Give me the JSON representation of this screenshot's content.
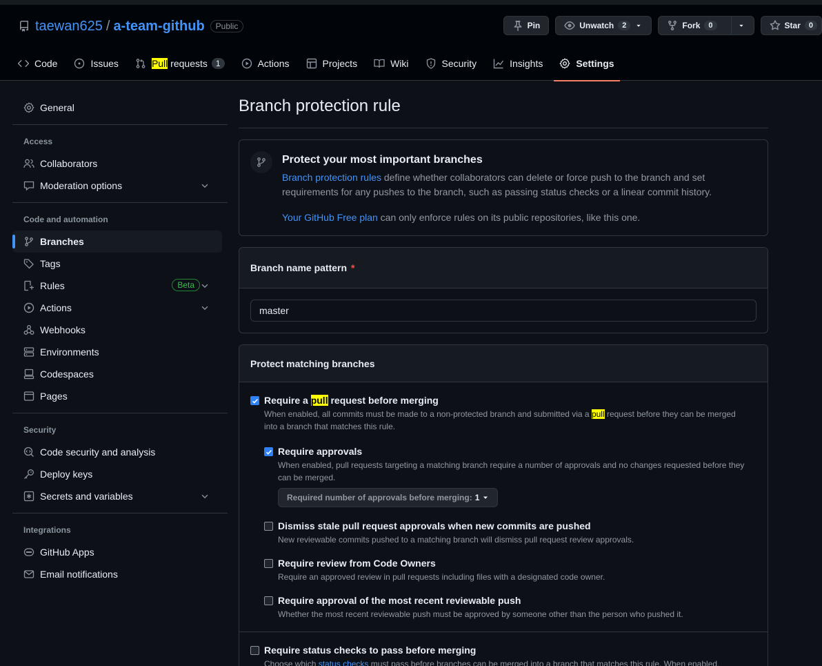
{
  "repo": {
    "owner": "taewan625",
    "name": "a-team-github",
    "visibility": "Public"
  },
  "actions": {
    "pin": "Pin",
    "unwatch": "Unwatch",
    "watch_count": "2",
    "fork": "Fork",
    "fork_count": "0",
    "star": "Star",
    "star_count": "0"
  },
  "nav": {
    "code": "Code",
    "issues": "Issues",
    "pull_hl": "Pull",
    "pull_rest": " requests",
    "pull_count": "1",
    "actions": "Actions",
    "projects": "Projects",
    "wiki": "Wiki",
    "security": "Security",
    "insights": "Insights",
    "settings": "Settings"
  },
  "sidebar": {
    "general": "General",
    "access_heading": "Access",
    "collaborators": "Collaborators",
    "moderation": "Moderation options",
    "code_heading": "Code and automation",
    "branches": "Branches",
    "tags": "Tags",
    "rules": "Rules",
    "rules_badge": "Beta",
    "actions": "Actions",
    "webhooks": "Webhooks",
    "environments": "Environments",
    "codespaces": "Codespaces",
    "pages": "Pages",
    "security_heading": "Security",
    "code_security": "Code security and analysis",
    "deploy_keys": "Deploy keys",
    "secrets": "Secrets and variables",
    "integrations_heading": "Integrations",
    "github_apps": "GitHub Apps",
    "email_notifications": "Email notifications"
  },
  "main": {
    "title": "Branch protection rule",
    "flash_title": "Protect your most important branches",
    "flash_link1": "Branch protection rules",
    "flash_text1": " define whether collaborators can delete or force push to the branch and set requirements for any pushes to the branch, such as passing status checks or a linear commit history.",
    "flash_link2": "Your GitHub Free plan",
    "flash_text2": " can only enforce rules on its public repositories, like this one.",
    "pattern_label": "Branch name pattern",
    "pattern_required": "*",
    "pattern_value": "master",
    "protect_heading": "Protect matching branches",
    "opt1_pre": "Require a ",
    "opt1_hl": "pull",
    "opt1_post": " request before merging",
    "opt1_desc_pre": "When enabled, all commits must be made to a non-protected branch and submitted via a ",
    "opt1_desc_hl": "pull",
    "opt1_desc_post": " request before they can be merged into a branch that matches this rule.",
    "sub1_label": "Require approvals",
    "sub1_desc": "When enabled, pull requests targeting a matching branch require a number of approvals and no changes requested before they can be merged.",
    "sub1_select_label": "Required number of approvals before merging:",
    "sub1_select_value": "1",
    "sub2_label": "Dismiss stale pull request approvals when new commits are pushed",
    "sub2_desc": "New reviewable commits pushed to a matching branch will dismiss pull request review approvals.",
    "sub3_label": "Require review from Code Owners",
    "sub3_desc": "Require an approved review in pull requests including files with a designated code owner.",
    "sub4_label": "Require approval of the most recent reviewable push",
    "sub4_desc": "Whether the most recent reviewable push must be approved by someone other than the person who pushed it.",
    "opt2_label": "Require status checks to pass before merging",
    "opt2_desc_pre": "Choose which ",
    "opt2_desc_link": "status checks",
    "opt2_desc_post": " must pass before branches can be merged into a branch that matches this rule. When enabled,"
  }
}
